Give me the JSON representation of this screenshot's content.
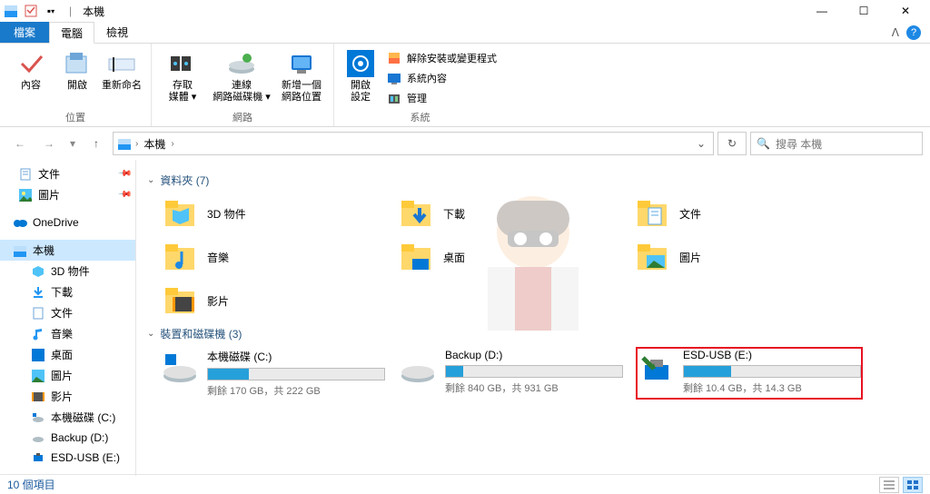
{
  "title": "本機",
  "qat": {
    "dropdown": "▾"
  },
  "wincontrols": {
    "min": "—",
    "max": "☐",
    "close": "✕"
  },
  "tabs": {
    "file": "檔案",
    "computer": "電腦",
    "view": "檢視",
    "caret": "ᐱ"
  },
  "ribbon": {
    "location": {
      "props": "內容",
      "open": "開啟",
      "rename": "重新命名",
      "group": "位置"
    },
    "network": {
      "media": "存取",
      "media2": "媒體 ▾",
      "mapdrive": "連線",
      "mapdrive2": "網路磁碟機 ▾",
      "addloc": "新增一個",
      "addloc2": "網路位置",
      "group": "網路"
    },
    "system": {
      "settings": "開啟",
      "settings2": "設定",
      "uninstall": "解除安裝或變更程式",
      "sysprops": "系統內容",
      "manage": "管理",
      "group": "系統"
    }
  },
  "nav": {
    "back": "←",
    "forward": "→",
    "recent": "▾",
    "up": "↑"
  },
  "address": {
    "root": "本機",
    "sep": "›",
    "dropdown": "⌄",
    "refresh": "↻"
  },
  "search": {
    "icon": "🔍",
    "placeholder": "搜尋 本機"
  },
  "navpane": {
    "docs": "文件",
    "pics": "圖片",
    "onedrive": "OneDrive",
    "thispc": "本機",
    "obj3d": "3D 物件",
    "downloads": "下載",
    "docs2": "文件",
    "music": "音樂",
    "desktop": "桌面",
    "pics2": "圖片",
    "videos": "影片",
    "cdrive": "本機磁碟 (C:)",
    "ddrive": "Backup (D:)",
    "edrive": "ESD-USB (E:)"
  },
  "content": {
    "folders_hdr": "資料夾 (7)",
    "folders": {
      "obj3d": "3D 物件",
      "downloads": "下載",
      "docs": "文件",
      "music": "音樂",
      "desktop": "桌面",
      "pics": "圖片",
      "videos": "影片"
    },
    "drives_hdr": "裝置和磁碟機 (3)",
    "drives": {
      "c": {
        "name": "本機磁碟 (C:)",
        "text": "剩餘 170 GB，共 222 GB",
        "pct": 23
      },
      "d": {
        "name": "Backup (D:)",
        "text": "剩餘 840 GB，共 931 GB",
        "pct": 10
      },
      "e": {
        "name": "ESD-USB (E:)",
        "text": "剩餘 10.4 GB，共 14.3 GB",
        "pct": 27
      }
    }
  },
  "status": {
    "count": "10 個項目"
  }
}
